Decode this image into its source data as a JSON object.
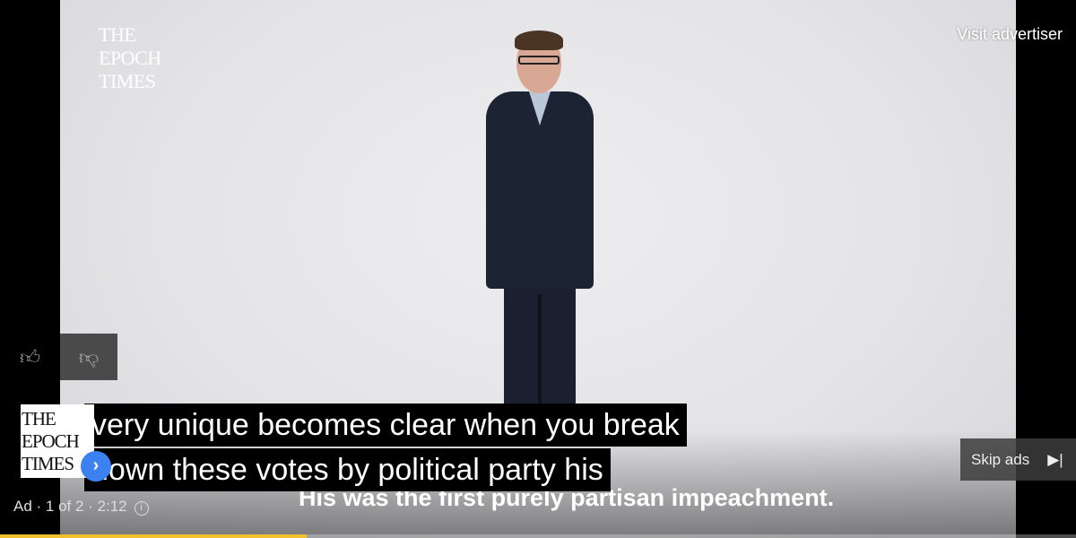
{
  "video": {
    "brand_logo": "THE EPOCH TIMES",
    "brand_logo_lines": [
      "THE",
      "EPOCH",
      "TIMES"
    ],
    "visit_advertiser": "Visit advertiser",
    "captions": [
      "very unique becomes clear when you break",
      "down these votes by political party his"
    ],
    "burned_text": "His was the first purely partisan impeachment."
  },
  "ad": {
    "info": "Ad · 1 of 2 · 2:12",
    "info_icon": "info-icon",
    "logo_lines": [
      "THE",
      "EPOCH",
      "TIMES"
    ],
    "skip_label": "Skip ads",
    "progress_percent": 28.5,
    "progress_color": "#f2c12e",
    "chevron_color": "#3b82f0"
  },
  "icons": {
    "like": "thumbs-up-icon",
    "dislike": "thumbs-down-icon",
    "skip": "skip-next-icon",
    "expand": "chevron-right-icon"
  }
}
